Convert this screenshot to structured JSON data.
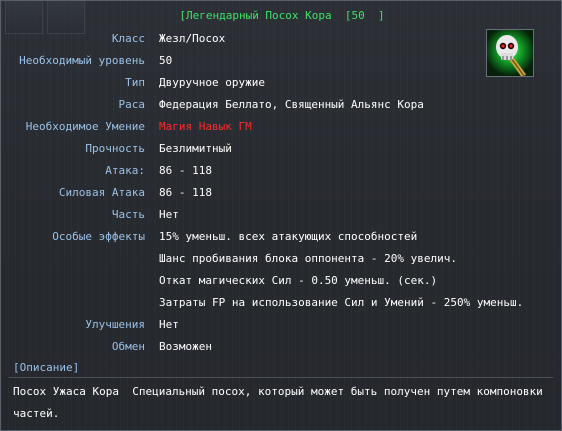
{
  "tooltip": {
    "title": "[Легендарный Посох Кора  [50  ]",
    "icon": "skull-staff-icon",
    "rows": [
      {
        "label": "Класс",
        "value": "Жезл/Посох"
      },
      {
        "label": "Необходимый уровень",
        "value": "50"
      },
      {
        "label": "Тип",
        "value": "Двуручное оружие"
      },
      {
        "label": "Раса",
        "value": "Федерация Беллато, Священный Альянс Кора"
      },
      {
        "label": "Необходимое Умение",
        "value": "Магия Навык ГМ"
      },
      {
        "label": "Прочность",
        "value": "Безлимитный"
      },
      {
        "label": "Атака:",
        "value": "86 - 118"
      },
      {
        "label": "Силовая Атака",
        "value": "86 - 118"
      },
      {
        "label": "Часть",
        "value": "Нет"
      },
      {
        "label": "Особые эффекты",
        "value": "15% уменьш. всех атакующих способностей"
      },
      {
        "label": "",
        "value": "Шанс пробивания блока оппонента - 20% увелич."
      },
      {
        "label": "",
        "value": "Откат магических Сил - 0.50 уменьш. (сек.)"
      },
      {
        "label": "",
        "value": "Затраты FP на использование Сил и Умений - 250% уменьш."
      },
      {
        "label": "Улучшения",
        "value": "Нет"
      },
      {
        "label": "Обмен",
        "value": "Возможен"
      }
    ],
    "description_header": "[Описание]",
    "description": "Посох Ужаса Кора  Специальный посох, который может быть получен путем компоновки частей."
  },
  "colors": {
    "title": "#3ee06a",
    "label": "#9bc0e6",
    "value": "#ffffff",
    "requirement_unmet": "#ff2a2a"
  }
}
